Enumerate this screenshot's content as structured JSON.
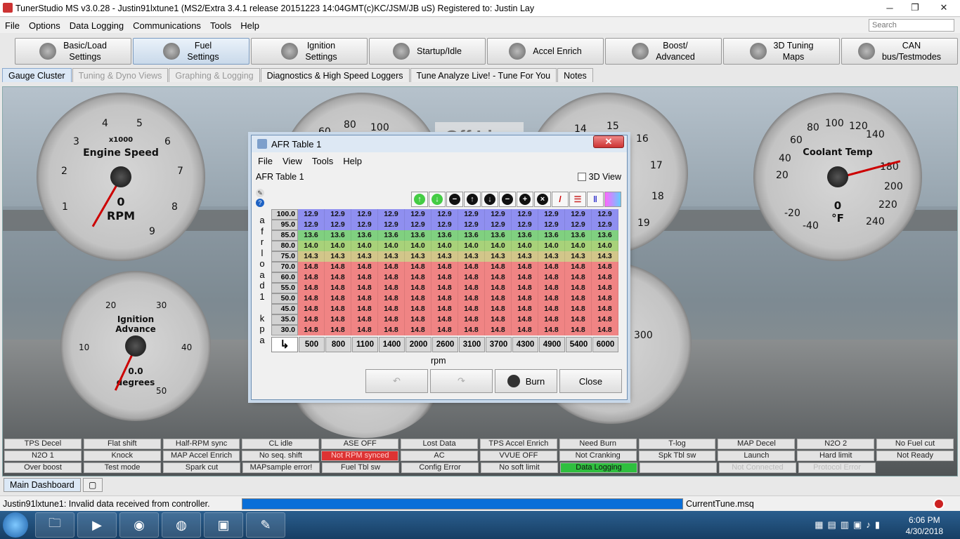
{
  "window": {
    "title": "TunerStudio MS v3.0.28 - Justin91lxtune1 (MS2/Extra 3.4.1 release  20151223 14:04GMT(c)KC/JSM/JB    uS) Registered to: Justin Lay"
  },
  "menu": [
    "File",
    "Options",
    "Data Logging",
    "Communications",
    "Tools",
    "Help"
  ],
  "search": {
    "placeholder": "Search"
  },
  "toolbar": [
    {
      "l1": "Basic/Load",
      "l2": "Settings"
    },
    {
      "l1": "Fuel",
      "l2": "Settings"
    },
    {
      "l1": "Ignition",
      "l2": "Settings"
    },
    {
      "l1": "Startup/Idle",
      "l2": ""
    },
    {
      "l1": "Accel Enrich",
      "l2": ""
    },
    {
      "l1": "Boost/",
      "l2": "Advanced"
    },
    {
      "l1": "3D Tuning",
      "l2": "Maps"
    },
    {
      "l1": "CAN",
      "l2": "bus/Testmodes"
    }
  ],
  "tabs": [
    "Gauge Cluster",
    "Tuning & Dyno Views",
    "Graphing & Logging",
    "Diagnostics & High Speed Loggers",
    "Tune Analyze Live! - Tune For You",
    "Notes"
  ],
  "gauges": {
    "rpm": {
      "title": "Engine Speed",
      "mult": "x1000",
      "unit": "RPM",
      "value": "0",
      "ticks": [
        "1",
        "2",
        "3",
        "4",
        "5",
        "6",
        "7",
        "8",
        "9"
      ]
    },
    "ign": {
      "title1": "Ignition",
      "title2": "Advance",
      "value": "0.0",
      "unit": "degrees",
      "ticks": [
        "10",
        "20",
        "30",
        "40",
        "50"
      ]
    },
    "clt": {
      "title": "Coolant Temp",
      "value": "0",
      "unit": "°F",
      "ticks": [
        "-40",
        "-20",
        "20",
        "40",
        "60",
        "80",
        "100",
        "120",
        "140",
        "180",
        "200",
        "220",
        "240"
      ]
    },
    "mid": {
      "ticks": [
        "60",
        "80",
        "100"
      ]
    },
    "right2": {
      "ticks": [
        "14",
        "15",
        "16",
        "17",
        "18",
        "19"
      ]
    },
    "bottom2": {
      "ticks": [
        "300"
      ]
    },
    "offline": "Off Line"
  },
  "dialog": {
    "title": "AFR Table 1",
    "menu": [
      "File",
      "View",
      "Tools",
      "Help"
    ],
    "label": "AFR Table 1",
    "view3d": "3D View",
    "ylabel": "afrload1 kpa",
    "xlabel": "rpm",
    "rows": [
      {
        "load": "100.0",
        "cls": "c129",
        "vals": [
          "12.9",
          "12.9",
          "12.9",
          "12.9",
          "12.9",
          "12.9",
          "12.9",
          "12.9",
          "12.9",
          "12.9",
          "12.9",
          "12.9"
        ]
      },
      {
        "load": "95.0",
        "cls": "c129",
        "vals": [
          "12.9",
          "12.9",
          "12.9",
          "12.9",
          "12.9",
          "12.9",
          "12.9",
          "12.9",
          "12.9",
          "12.9",
          "12.9",
          "12.9"
        ]
      },
      {
        "load": "85.0",
        "cls": "c136",
        "vals": [
          "13.6",
          "13.6",
          "13.6",
          "13.6",
          "13.6",
          "13.6",
          "13.6",
          "13.6",
          "13.6",
          "13.6",
          "13.6",
          "13.6"
        ]
      },
      {
        "load": "80.0",
        "cls": "c140",
        "vals": [
          "14.0",
          "14.0",
          "14.0",
          "14.0",
          "14.0",
          "14.0",
          "14.0",
          "14.0",
          "14.0",
          "14.0",
          "14.0",
          "14.0"
        ]
      },
      {
        "load": "75.0",
        "cls": "c143",
        "vals": [
          "14.3",
          "14.3",
          "14.3",
          "14.3",
          "14.3",
          "14.3",
          "14.3",
          "14.3",
          "14.3",
          "14.3",
          "14.3",
          "14.3"
        ]
      },
      {
        "load": "70.0",
        "cls": "c148",
        "vals": [
          "14.8",
          "14.8",
          "14.8",
          "14.8",
          "14.8",
          "14.8",
          "14.8",
          "14.8",
          "14.8",
          "14.8",
          "14.8",
          "14.8"
        ]
      },
      {
        "load": "60.0",
        "cls": "c148",
        "vals": [
          "14.8",
          "14.8",
          "14.8",
          "14.8",
          "14.8",
          "14.8",
          "14.8",
          "14.8",
          "14.8",
          "14.8",
          "14.8",
          "14.8"
        ]
      },
      {
        "load": "55.0",
        "cls": "c148",
        "vals": [
          "14.8",
          "14.8",
          "14.8",
          "14.8",
          "14.8",
          "14.8",
          "14.8",
          "14.8",
          "14.8",
          "14.8",
          "14.8",
          "14.8"
        ]
      },
      {
        "load": "50.0",
        "cls": "c148",
        "vals": [
          "14.8",
          "14.8",
          "14.8",
          "14.8",
          "14.8",
          "14.8",
          "14.8",
          "14.8",
          "14.8",
          "14.8",
          "14.8",
          "14.8"
        ]
      },
      {
        "load": "45.0",
        "cls": "c148",
        "vals": [
          "14.8",
          "14.8",
          "14.8",
          "14.8",
          "14.8",
          "14.8",
          "14.8",
          "14.8",
          "14.8",
          "14.8",
          "14.8",
          "14.8"
        ]
      },
      {
        "load": "35.0",
        "cls": "c148",
        "vals": [
          "14.8",
          "14.8",
          "14.8",
          "14.8",
          "14.8",
          "14.8",
          "14.8",
          "14.8",
          "14.8",
          "14.8",
          "14.8",
          "14.8"
        ]
      },
      {
        "load": "30.0",
        "cls": "c148",
        "vals": [
          "14.8",
          "14.8",
          "14.8",
          "14.8",
          "14.8",
          "14.8",
          "14.8",
          "14.8",
          "14.8",
          "14.8",
          "14.8",
          "14.8"
        ]
      }
    ],
    "rpm": [
      "500",
      "800",
      "1100",
      "1400",
      "2000",
      "2600",
      "3100",
      "3700",
      "4300",
      "4900",
      "5400",
      "6000"
    ],
    "buttons": {
      "burn": "Burn",
      "close": "Close"
    }
  },
  "indicators": [
    [
      {
        "t": "TPS Decel"
      },
      {
        "t": "Flat shift"
      },
      {
        "t": "Half-RPM sync"
      },
      {
        "t": "CL idle"
      },
      {
        "t": "ASE OFF"
      },
      {
        "t": "Lost Data"
      },
      {
        "t": "TPS Accel Enrich"
      },
      {
        "t": "Need Burn"
      },
      {
        "t": "T-log"
      },
      {
        "t": "MAP Decel"
      },
      {
        "t": "N2O 2"
      },
      {
        "t": "No Fuel cut"
      }
    ],
    [
      {
        "t": "N2O 1"
      },
      {
        "t": "Knock"
      },
      {
        "t": "MAP Accel Enrich"
      },
      {
        "t": "No seq. shift"
      },
      {
        "t": "Not RPM synced",
        "s": "red"
      },
      {
        "t": "AC"
      },
      {
        "t": "VVUE OFF"
      },
      {
        "t": "Not Cranking"
      },
      {
        "t": "Spk Tbl sw"
      },
      {
        "t": "Launch"
      },
      {
        "t": "Hard limit"
      },
      {
        "t": "Not Ready"
      }
    ],
    [
      {
        "t": "Over boost"
      },
      {
        "t": "Test mode"
      },
      {
        "t": "Spark cut"
      },
      {
        "t": "MAPsample error!"
      },
      {
        "t": "Fuel Tbl sw"
      },
      {
        "t": "Config Error"
      },
      {
        "t": "No soft limit"
      },
      {
        "t": "Data Logging",
        "s": "green"
      },
      {
        "t": ""
      },
      {
        "t": "Not Connected",
        "s": "dim"
      },
      {
        "t": "Protocol Error",
        "s": "dim"
      }
    ]
  ],
  "bottom_tab": "Main Dashboard",
  "statusbar": {
    "message": "Justin91lxtune1: Invalid data received from controller.",
    "file": "CurrentTune.msq",
    "progress": 1.0
  },
  "clock": {
    "time": "6:06 PM",
    "date": "4/30/2018"
  }
}
